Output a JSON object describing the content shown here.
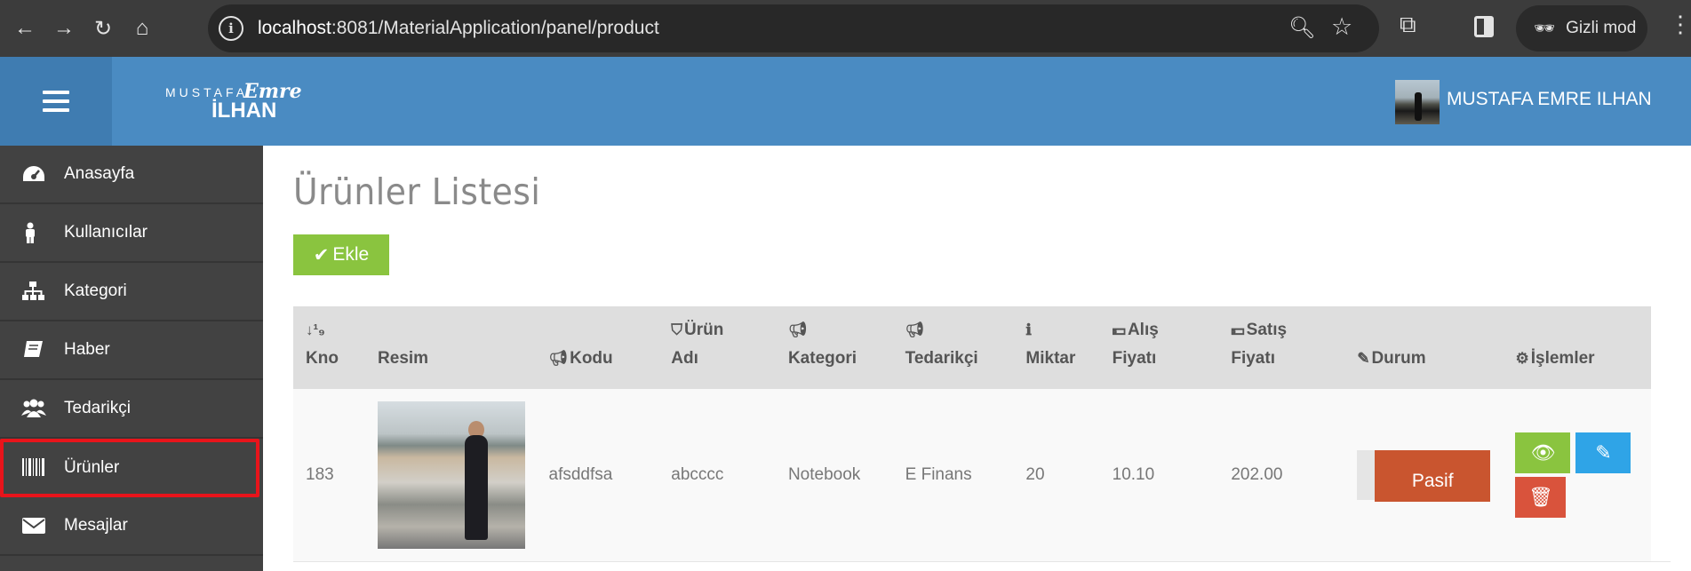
{
  "browser": {
    "url_host": "localhost",
    "url_rest": ":8081/MaterialApplication/panel/product",
    "incognito_label": "Gizli mod"
  },
  "header": {
    "logo_line1": "MUSTAFA",
    "logo_line2": "Emre",
    "logo_line3": "İLHAN",
    "user_name": "MUSTAFA EMRE ILHAN"
  },
  "sidebar": {
    "items": [
      {
        "label": "Anasayfa",
        "icon": "dashboard-icon"
      },
      {
        "label": "Kullanıcılar",
        "icon": "user-icon"
      },
      {
        "label": "Kategori",
        "icon": "sitemap-icon"
      },
      {
        "label": "Haber",
        "icon": "book-icon"
      },
      {
        "label": "Tedarikçi",
        "icon": "users-icon"
      },
      {
        "label": "Ürünler",
        "icon": "barcode-icon",
        "highlighted": true
      },
      {
        "label": "Mesajlar",
        "icon": "envelope-icon"
      }
    ]
  },
  "main": {
    "title": "Ürünler Listesi",
    "add_button": "Ekle",
    "columns": [
      {
        "line1": "",
        "line2": "Kno",
        "icon": "sort-numeric-icon"
      },
      {
        "line1": "",
        "line2": "Resim",
        "icon": ""
      },
      {
        "line1": "",
        "line2": "Kodu",
        "icon": "bullhorn-icon"
      },
      {
        "line1": "Ürün",
        "line2": "Adı",
        "icon": "shield-icon"
      },
      {
        "line1": "",
        "line2": "Kategori",
        "icon": "bullhorn-icon"
      },
      {
        "line1": "",
        "line2": "Tedarikçi",
        "icon": "bullhorn-icon"
      },
      {
        "line1": "",
        "line2": "Miktar",
        "icon": "info-icon"
      },
      {
        "line1": "Alış",
        "line2": "Fiyatı",
        "icon": "money-icon"
      },
      {
        "line1": "Satış",
        "line2": "Fiyatı",
        "icon": "money-icon"
      },
      {
        "line1": "",
        "line2": "Durum",
        "icon": "edit-icon"
      },
      {
        "line1": "",
        "line2": "İşlemler",
        "icon": "cogs-icon"
      }
    ],
    "rows": [
      {
        "kno": "183",
        "kodu": "afsddfsa",
        "urun_adi": "abcccc",
        "kategori": "Notebook",
        "tedarikci": "E Finans",
        "miktar": "20",
        "alis_fiyati": "10.10",
        "satis_fiyati": "202.00",
        "durum": "Pasif"
      }
    ]
  }
}
